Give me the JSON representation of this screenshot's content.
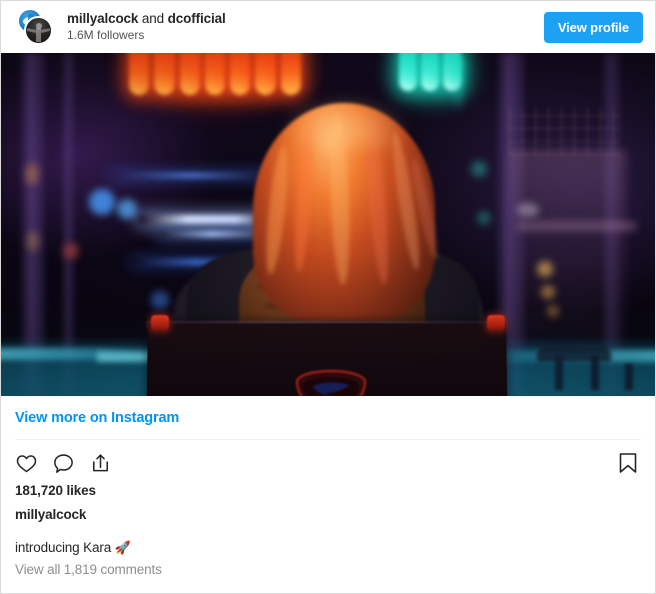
{
  "header": {
    "avatar_primary": "dark-profile-avatar",
    "avatar_secondary": "blue-profile-avatar",
    "username_primary": "millyalcock",
    "conjunction": " and ",
    "username_secondary": "dcofficial",
    "followers": "1.6M followers",
    "view_profile_label": "View profile",
    "button_color": "#1da1f2"
  },
  "post": {
    "media_alt": "Person with long red hair seen from behind sitting in a director's chair bearing the Superman shield logo, neon-lit bar in the background",
    "view_more_label": "View more on Instagram",
    "likes": "181,720 likes",
    "caption_username": "millyalcock",
    "caption_text": "introducing Kara ",
    "caption_emoji": "🚀",
    "comments_label": "View all 1,819 comments",
    "link_color": "#0095f6",
    "muted_color": "#8e8e8e"
  },
  "actions": [
    {
      "name": "like-icon",
      "label": "Like"
    },
    {
      "name": "comment-icon",
      "label": "Comment"
    },
    {
      "name": "share-icon",
      "label": "Share"
    }
  ],
  "save_action": {
    "name": "bookmark-icon",
    "label": "Save"
  }
}
